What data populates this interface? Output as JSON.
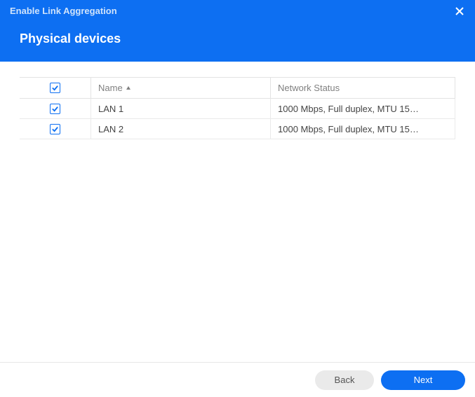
{
  "header": {
    "breadcrumb": "Enable Link Aggregation",
    "title": "Physical devices"
  },
  "table": {
    "columns": {
      "name": "Name",
      "status": "Network Status"
    },
    "rows": [
      {
        "checked": true,
        "name": "LAN 1",
        "status": "1000 Mbps, Full duplex, MTU 15…"
      },
      {
        "checked": true,
        "name": "LAN 2",
        "status": "1000 Mbps, Full duplex, MTU 15…"
      }
    ],
    "select_all": true
  },
  "footer": {
    "back_label": "Back",
    "next_label": "Next"
  }
}
